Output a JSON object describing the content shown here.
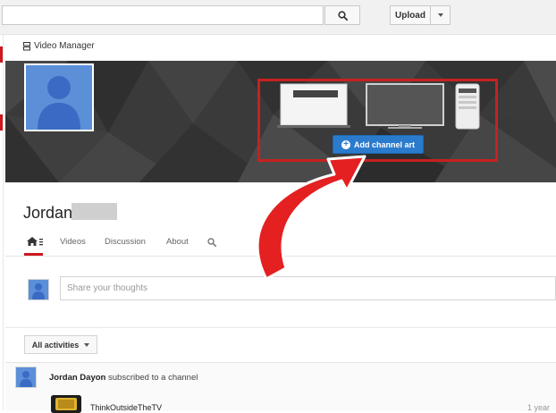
{
  "search": {
    "value": "",
    "placeholder": ""
  },
  "header": {
    "upload_label": "Upload"
  },
  "video_manager": {
    "label": "Video Manager"
  },
  "banner": {
    "add_channel_art_label": "Add channel art"
  },
  "channel": {
    "name": "Jordan"
  },
  "tabs": [
    {
      "label": "Videos"
    },
    {
      "label": "Discussion"
    },
    {
      "label": "About"
    }
  ],
  "share": {
    "placeholder": "Share your thoughts"
  },
  "activities": {
    "filter_label": "All activities"
  },
  "feed": {
    "user": "Jordan Dayon",
    "action": " subscribed to a channel",
    "channel_title": "ThinkOutsideTheTV",
    "time": "1 year"
  },
  "colors": {
    "accent_red": "#cc181e",
    "annotation_red": "#c82020",
    "button_blue": "#2b7bcd",
    "avatar_blue": "#5b8fd8",
    "banner_dark": "#3a3a3a"
  },
  "icons": [
    "search-icon",
    "dropdown-caret-icon",
    "video-manager-icon",
    "plus-circle-icon",
    "home-icon",
    "tab-search-icon",
    "default-avatar-icon",
    "device-desktop-icon",
    "device-tv-icon",
    "device-phone-icon",
    "annotation-arrow-icon"
  ]
}
